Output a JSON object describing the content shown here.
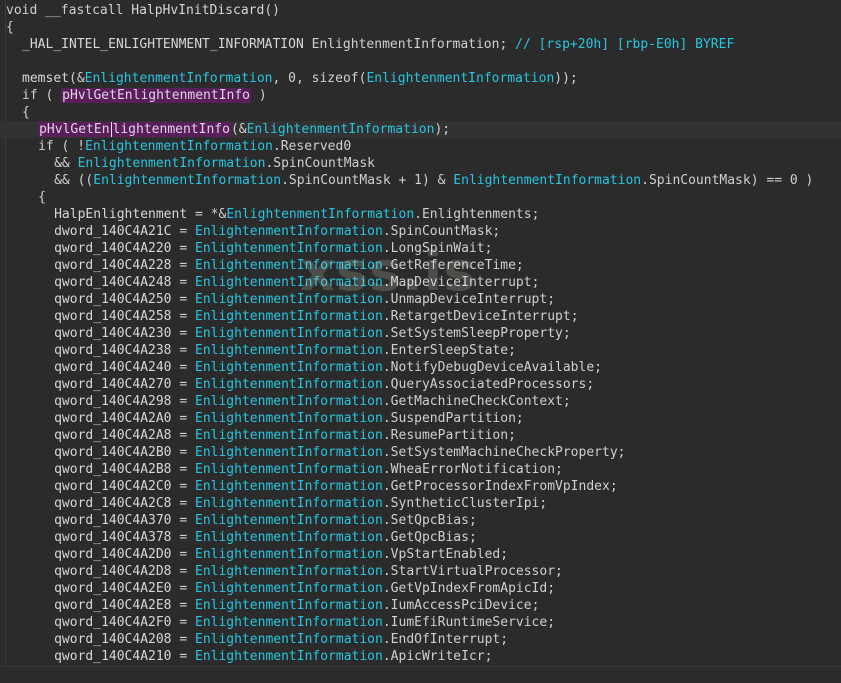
{
  "watermark": "xss.is",
  "lines": [
    {
      "indent": 0,
      "tokens": [
        [
          "kw",
          "void"
        ],
        [
          "p",
          " "
        ],
        [
          "kw",
          "__fastcall"
        ],
        [
          "p",
          " "
        ],
        [
          "fn",
          "HalpHvInitDiscard"
        ],
        [
          "p",
          "()"
        ]
      ]
    },
    {
      "indent": 0,
      "tokens": [
        [
          "p",
          "{"
        ]
      ]
    },
    {
      "indent": 2,
      "tokens": [
        [
          "type",
          "_HAL_INTEL_ENLIGHTENMENT_INFORMATION"
        ],
        [
          "p",
          " "
        ],
        [
          "id",
          "EnlightenmentInformation"
        ],
        [
          "p",
          "; "
        ],
        [
          "cm",
          "// [rsp+20h] [rbp-E0h] BYREF"
        ]
      ]
    },
    {
      "indent": 0,
      "tokens": []
    },
    {
      "indent": 2,
      "tokens": [
        [
          "fn",
          "memset"
        ],
        [
          "p",
          "(&"
        ],
        [
          "var",
          "EnlightenmentInformation"
        ],
        [
          "p",
          ", "
        ],
        [
          "num",
          "0"
        ],
        [
          "p",
          ", "
        ],
        [
          "kw",
          "sizeof"
        ],
        [
          "p",
          "("
        ],
        [
          "var",
          "EnlightenmentInformation"
        ],
        [
          "p",
          "));"
        ]
      ]
    },
    {
      "indent": 2,
      "tokens": [
        [
          "kw",
          "if"
        ],
        [
          "p",
          " ( "
        ],
        [
          "fnhl",
          "pHvlGetEnlightenmentInfo"
        ],
        [
          "p",
          " )"
        ]
      ]
    },
    {
      "indent": 2,
      "tokens": [
        [
          "p",
          "{"
        ]
      ]
    },
    {
      "indent": 4,
      "current": true,
      "tokens": [
        [
          "fnhl",
          "pHvlGetEn"
        ],
        [
          "caret",
          ""
        ],
        [
          "fnhl",
          "lightenmentInfo"
        ],
        [
          "p",
          "(&"
        ],
        [
          "var",
          "EnlightenmentInformation"
        ],
        [
          "p",
          ");"
        ]
      ]
    },
    {
      "indent": 4,
      "tokens": [
        [
          "kw",
          "if"
        ],
        [
          "p",
          " ( !"
        ],
        [
          "var",
          "EnlightenmentInformation"
        ],
        [
          "p",
          "."
        ],
        [
          "mem",
          "Reserved0"
        ]
      ]
    },
    {
      "indent": 6,
      "tokens": [
        [
          "p",
          "&& "
        ],
        [
          "var",
          "EnlightenmentInformation"
        ],
        [
          "p",
          "."
        ],
        [
          "mem",
          "SpinCountMask"
        ]
      ]
    },
    {
      "indent": 6,
      "tokens": [
        [
          "p",
          "&& (("
        ],
        [
          "var",
          "EnlightenmentInformation"
        ],
        [
          "p",
          "."
        ],
        [
          "mem",
          "SpinCountMask"
        ],
        [
          "p",
          " + "
        ],
        [
          "num",
          "1"
        ],
        [
          "p",
          ") & "
        ],
        [
          "var",
          "EnlightenmentInformation"
        ],
        [
          "p",
          "."
        ],
        [
          "mem",
          "SpinCountMask"
        ],
        [
          "p",
          ") == "
        ],
        [
          "num",
          "0"
        ],
        [
          "p",
          " )"
        ]
      ]
    },
    {
      "indent": 4,
      "tokens": [
        [
          "p",
          "{"
        ]
      ]
    },
    {
      "indent": 6,
      "tokens": [
        [
          "glob",
          "HalpEnlightenment"
        ],
        [
          "p",
          " = *&"
        ],
        [
          "var",
          "EnlightenmentInformation"
        ],
        [
          "p",
          "."
        ],
        [
          "mem",
          "Enlightenments"
        ],
        [
          "p",
          ";"
        ]
      ]
    },
    {
      "indent": 6,
      "tokens": [
        [
          "glob",
          "dword_140C4A21C"
        ],
        [
          "p",
          " = "
        ],
        [
          "var",
          "EnlightenmentInformation"
        ],
        [
          "p",
          "."
        ],
        [
          "mem",
          "SpinCountMask"
        ],
        [
          "p",
          ";"
        ]
      ]
    },
    {
      "indent": 6,
      "tokens": [
        [
          "glob",
          "qword_140C4A220"
        ],
        [
          "p",
          " = "
        ],
        [
          "var",
          "EnlightenmentInformation"
        ],
        [
          "p",
          "."
        ],
        [
          "mem",
          "LongSpinWait"
        ],
        [
          "p",
          ";"
        ]
      ]
    },
    {
      "indent": 6,
      "tokens": [
        [
          "glob",
          "qword_140C4A228"
        ],
        [
          "p",
          " = "
        ],
        [
          "var",
          "EnlightenmentInformation"
        ],
        [
          "p",
          "."
        ],
        [
          "mem",
          "GetReferenceTime"
        ],
        [
          "p",
          ";"
        ]
      ]
    },
    {
      "indent": 6,
      "tokens": [
        [
          "glob",
          "qword_140C4A248"
        ],
        [
          "p",
          " = "
        ],
        [
          "var",
          "EnlightenmentInformation"
        ],
        [
          "p",
          "."
        ],
        [
          "mem",
          "MapDeviceInterrupt"
        ],
        [
          "p",
          ";"
        ]
      ]
    },
    {
      "indent": 6,
      "tokens": [
        [
          "glob",
          "qword_140C4A250"
        ],
        [
          "p",
          " = "
        ],
        [
          "var",
          "EnlightenmentInformation"
        ],
        [
          "p",
          "."
        ],
        [
          "mem",
          "UnmapDeviceInterrupt"
        ],
        [
          "p",
          ";"
        ]
      ]
    },
    {
      "indent": 6,
      "tokens": [
        [
          "glob",
          "qword_140C4A258"
        ],
        [
          "p",
          " = "
        ],
        [
          "var",
          "EnlightenmentInformation"
        ],
        [
          "p",
          "."
        ],
        [
          "mem",
          "RetargetDeviceInterrupt"
        ],
        [
          "p",
          ";"
        ]
      ]
    },
    {
      "indent": 6,
      "tokens": [
        [
          "glob",
          "qword_140C4A230"
        ],
        [
          "p",
          " = "
        ],
        [
          "var",
          "EnlightenmentInformation"
        ],
        [
          "p",
          "."
        ],
        [
          "mem",
          "SetSystemSleepProperty"
        ],
        [
          "p",
          ";"
        ]
      ]
    },
    {
      "indent": 6,
      "tokens": [
        [
          "glob",
          "qword_140C4A238"
        ],
        [
          "p",
          " = "
        ],
        [
          "var",
          "EnlightenmentInformation"
        ],
        [
          "p",
          "."
        ],
        [
          "mem",
          "EnterSleepState"
        ],
        [
          "p",
          ";"
        ]
      ]
    },
    {
      "indent": 6,
      "tokens": [
        [
          "glob",
          "qword_140C4A240"
        ],
        [
          "p",
          " = "
        ],
        [
          "var",
          "EnlightenmentInformation"
        ],
        [
          "p",
          "."
        ],
        [
          "mem",
          "NotifyDebugDeviceAvailable"
        ],
        [
          "p",
          ";"
        ]
      ]
    },
    {
      "indent": 6,
      "tokens": [
        [
          "glob",
          "qword_140C4A270"
        ],
        [
          "p",
          " = "
        ],
        [
          "var",
          "EnlightenmentInformation"
        ],
        [
          "p",
          "."
        ],
        [
          "mem",
          "QueryAssociatedProcessors"
        ],
        [
          "p",
          ";"
        ]
      ]
    },
    {
      "indent": 6,
      "tokens": [
        [
          "glob",
          "qword_140C4A298"
        ],
        [
          "p",
          " = "
        ],
        [
          "var",
          "EnlightenmentInformation"
        ],
        [
          "p",
          "."
        ],
        [
          "mem",
          "GetMachineCheckContext"
        ],
        [
          "p",
          ";"
        ]
      ]
    },
    {
      "indent": 6,
      "tokens": [
        [
          "glob",
          "qword_140C4A2A0"
        ],
        [
          "p",
          " = "
        ],
        [
          "var",
          "EnlightenmentInformation"
        ],
        [
          "p",
          "."
        ],
        [
          "mem",
          "SuspendPartition"
        ],
        [
          "p",
          ";"
        ]
      ]
    },
    {
      "indent": 6,
      "tokens": [
        [
          "glob",
          "qword_140C4A2A8"
        ],
        [
          "p",
          " = "
        ],
        [
          "var",
          "EnlightenmentInformation"
        ],
        [
          "p",
          "."
        ],
        [
          "mem",
          "ResumePartition"
        ],
        [
          "p",
          ";"
        ]
      ]
    },
    {
      "indent": 6,
      "tokens": [
        [
          "glob",
          "qword_140C4A2B0"
        ],
        [
          "p",
          " = "
        ],
        [
          "var",
          "EnlightenmentInformation"
        ],
        [
          "p",
          "."
        ],
        [
          "mem",
          "SetSystemMachineCheckProperty"
        ],
        [
          "p",
          ";"
        ]
      ]
    },
    {
      "indent": 6,
      "tokens": [
        [
          "glob",
          "qword_140C4A2B8"
        ],
        [
          "p",
          " = "
        ],
        [
          "var",
          "EnlightenmentInformation"
        ],
        [
          "p",
          "."
        ],
        [
          "mem",
          "WheaErrorNotification"
        ],
        [
          "p",
          ";"
        ]
      ]
    },
    {
      "indent": 6,
      "tokens": [
        [
          "glob",
          "qword_140C4A2C0"
        ],
        [
          "p",
          " = "
        ],
        [
          "var",
          "EnlightenmentInformation"
        ],
        [
          "p",
          "."
        ],
        [
          "mem",
          "GetProcessorIndexFromVpIndex"
        ],
        [
          "p",
          ";"
        ]
      ]
    },
    {
      "indent": 6,
      "tokens": [
        [
          "glob",
          "qword_140C4A2C8"
        ],
        [
          "p",
          " = "
        ],
        [
          "var",
          "EnlightenmentInformation"
        ],
        [
          "p",
          "."
        ],
        [
          "mem",
          "SyntheticClusterIpi"
        ],
        [
          "p",
          ";"
        ]
      ]
    },
    {
      "indent": 6,
      "tokens": [
        [
          "glob",
          "qword_140C4A370"
        ],
        [
          "p",
          " = "
        ],
        [
          "var",
          "EnlightenmentInformation"
        ],
        [
          "p",
          "."
        ],
        [
          "mem",
          "SetQpcBias"
        ],
        [
          "p",
          ";"
        ]
      ]
    },
    {
      "indent": 6,
      "tokens": [
        [
          "glob",
          "qword_140C4A378"
        ],
        [
          "p",
          " = "
        ],
        [
          "var",
          "EnlightenmentInformation"
        ],
        [
          "p",
          "."
        ],
        [
          "mem",
          "GetQpcBias"
        ],
        [
          "p",
          ";"
        ]
      ]
    },
    {
      "indent": 6,
      "tokens": [
        [
          "glob",
          "qword_140C4A2D0"
        ],
        [
          "p",
          " = "
        ],
        [
          "var",
          "EnlightenmentInformation"
        ],
        [
          "p",
          "."
        ],
        [
          "mem",
          "VpStartEnabled"
        ],
        [
          "p",
          ";"
        ]
      ]
    },
    {
      "indent": 6,
      "tokens": [
        [
          "glob",
          "qword_140C4A2D8"
        ],
        [
          "p",
          " = "
        ],
        [
          "var",
          "EnlightenmentInformation"
        ],
        [
          "p",
          "."
        ],
        [
          "mem",
          "StartVirtualProcessor"
        ],
        [
          "p",
          ";"
        ]
      ]
    },
    {
      "indent": 6,
      "tokens": [
        [
          "glob",
          "qword_140C4A2E0"
        ],
        [
          "p",
          " = "
        ],
        [
          "var",
          "EnlightenmentInformation"
        ],
        [
          "p",
          "."
        ],
        [
          "mem",
          "GetVpIndexFromApicId"
        ],
        [
          "p",
          ";"
        ]
      ]
    },
    {
      "indent": 6,
      "tokens": [
        [
          "glob",
          "qword_140C4A2E8"
        ],
        [
          "p",
          " = "
        ],
        [
          "var",
          "EnlightenmentInformation"
        ],
        [
          "p",
          "."
        ],
        [
          "mem",
          "IumAccessPciDevice"
        ],
        [
          "p",
          ";"
        ]
      ]
    },
    {
      "indent": 6,
      "tokens": [
        [
          "glob",
          "qword_140C4A2F0"
        ],
        [
          "p",
          " = "
        ],
        [
          "var",
          "EnlightenmentInformation"
        ],
        [
          "p",
          "."
        ],
        [
          "mem",
          "IumEfiRuntimeService"
        ],
        [
          "p",
          ";"
        ]
      ]
    },
    {
      "indent": 6,
      "tokens": [
        [
          "glob",
          "qword_140C4A208"
        ],
        [
          "p",
          " = "
        ],
        [
          "var",
          "EnlightenmentInformation"
        ],
        [
          "p",
          "."
        ],
        [
          "mem",
          "EndOfInterrupt"
        ],
        [
          "p",
          ";"
        ]
      ]
    },
    {
      "indent": 6,
      "tokens": [
        [
          "glob",
          "qword_140C4A210"
        ],
        [
          "p",
          " = "
        ],
        [
          "var",
          "EnlightenmentInformation"
        ],
        [
          "p",
          "."
        ],
        [
          "mem",
          "ApicWriteIcr"
        ],
        [
          "p",
          ";"
        ]
      ]
    }
  ]
}
